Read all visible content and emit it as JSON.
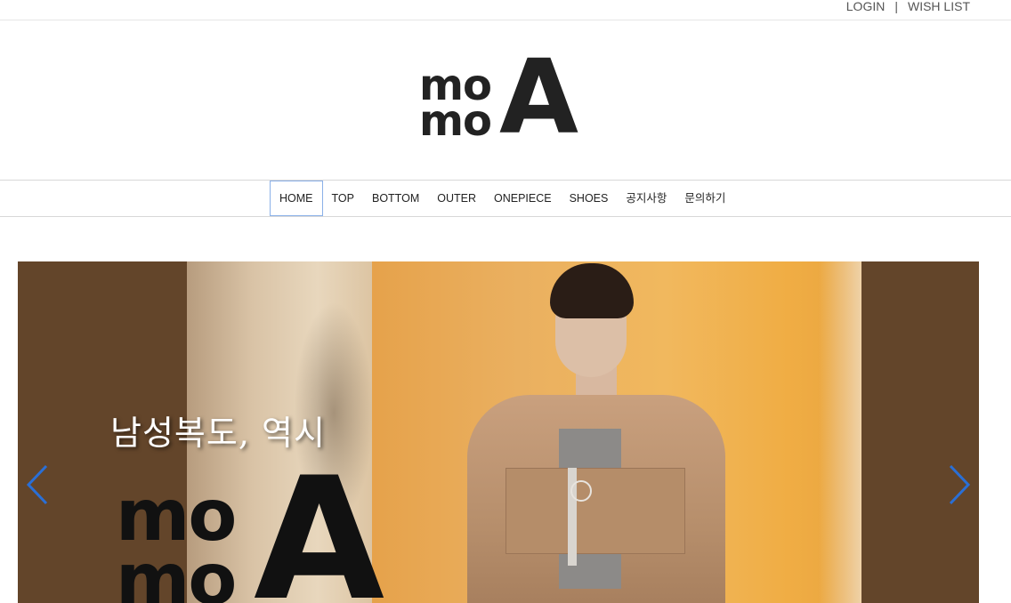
{
  "header": {
    "login_label": "LOGIN",
    "separator": "|",
    "wishlist_label": "WISH LIST"
  },
  "logo": {
    "line1": "mo",
    "line2": "mo",
    "big_letter": "A"
  },
  "nav": {
    "items": [
      {
        "label": "HOME",
        "active": true
      },
      {
        "label": "TOP"
      },
      {
        "label": "BOTTOM"
      },
      {
        "label": "OUTER"
      },
      {
        "label": "ONEPIECE"
      },
      {
        "label": "SHOES"
      },
      {
        "label": "공지사항"
      },
      {
        "label": "문의하기"
      }
    ]
  },
  "banner": {
    "headline": "남성복도, 역시",
    "logo_line1": "mo",
    "logo_line2": "mo",
    "logo_big_letter": "A",
    "prev_icon": "chevron-left-icon",
    "next_icon": "chevron-right-icon",
    "arrow_color": "#2a6fd6",
    "background_color": "#63452a"
  }
}
